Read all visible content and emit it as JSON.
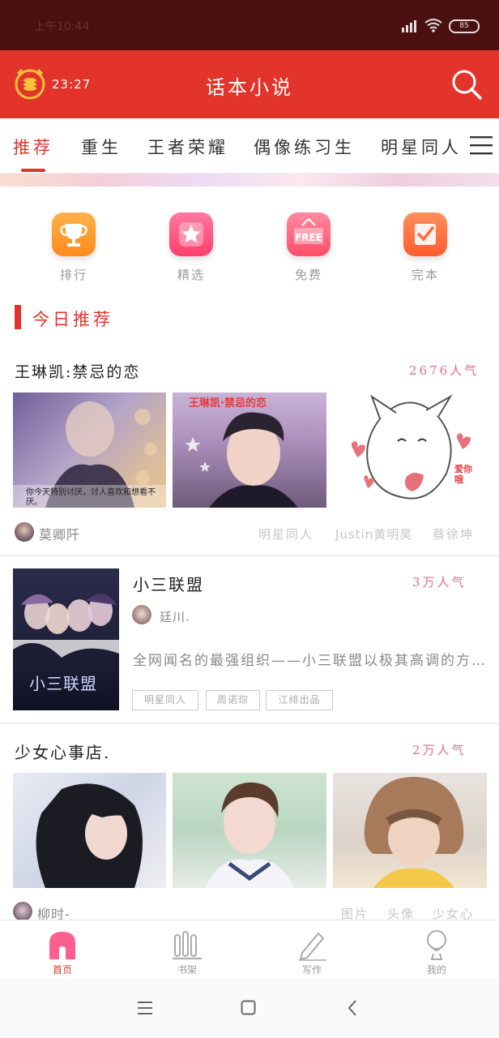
{
  "status_bar": {
    "time": "上午10:44",
    "battery": "85"
  },
  "app_bar": {
    "countdown": "23:27",
    "title": "话本小说"
  },
  "tabs": [
    {
      "label": "推荐",
      "active": true
    },
    {
      "label": "重生",
      "active": false
    },
    {
      "label": "王者荣耀",
      "active": false
    },
    {
      "label": "偶像练习生",
      "active": false
    },
    {
      "label": "明星同人",
      "active": false
    }
  ],
  "quick_links": [
    {
      "label": "排行",
      "icon": "trophy-icon",
      "color": "#ff9c2a"
    },
    {
      "label": "精选",
      "icon": "star-icon",
      "color": "#ff4f7d"
    },
    {
      "label": "免费",
      "icon": "free-tag-icon",
      "color": "#ff5a72",
      "badge": "FREE"
    },
    {
      "label": "完本",
      "icon": "checkbox-icon",
      "color": "#ff6b3d"
    }
  ],
  "section": {
    "title": "今日推荐"
  },
  "books": [
    {
      "title": "王琳凯:禁忌的恋",
      "popularity": "2676人气",
      "image_texts": [
        "你今天特别讨厌，讨人喜欢和想看不厌。",
        "王琳凯·禁忌的恋",
        "爱你哦"
      ],
      "author": "莫卿阡",
      "tags": [
        "明星同人",
        "Justin黄明昊",
        "蔡徐坤"
      ]
    },
    {
      "title": "小三联盟",
      "popularity": "3万人气",
      "author": "廷川.",
      "description": "全网闻名的最强组织——小三联盟以极其高调的方式出现",
      "tags": [
        "明星同人",
        "周诺琮",
        "江绯出品"
      ],
      "cover_text": "小三联盟"
    },
    {
      "title": "少女心事店.",
      "popularity": "2万人气",
      "author": "柳时-",
      "tags": [
        "图片",
        "头像",
        "少女心"
      ]
    }
  ],
  "bottom_nav": [
    {
      "label": "首页",
      "icon": "home-icon",
      "active": true
    },
    {
      "label": "书架",
      "icon": "bookshelf-icon",
      "active": false
    },
    {
      "label": "写作",
      "icon": "pencil-icon",
      "active": false
    },
    {
      "label": "我的",
      "icon": "profile-icon",
      "active": false
    }
  ],
  "colors": {
    "primary": "#e2342a",
    "status_bar": "#4a1010",
    "popularity": "#e56a8e"
  }
}
